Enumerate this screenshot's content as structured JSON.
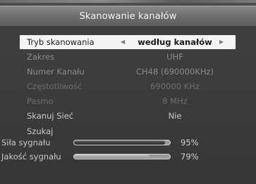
{
  "window": {
    "title": "Skanowanie kanałów"
  },
  "menu": {
    "rows": [
      {
        "label": "Tryb skanowania",
        "value": "według kanałów"
      },
      {
        "label": "Zakres",
        "value": "UHF"
      },
      {
        "label": "Numer Kanału",
        "value": "CH48 (690000KHz)"
      },
      {
        "label": "Częstotliwość",
        "value": "690000 KHz"
      },
      {
        "label": "Pasmo",
        "value": "8 MHz"
      },
      {
        "label": "Skanuj Sieć",
        "value": "Nie"
      },
      {
        "label": "Szukaj",
        "value": ""
      }
    ],
    "left_arrow": "◀",
    "right_arrow": "▶"
  },
  "signal": {
    "strength_label": "Siła sygnału",
    "strength_percent": "95%",
    "strength_fraction": 0.95,
    "quality_label": "Jakość sygnału",
    "quality_percent": "79%",
    "quality_fraction": 0.79
  }
}
